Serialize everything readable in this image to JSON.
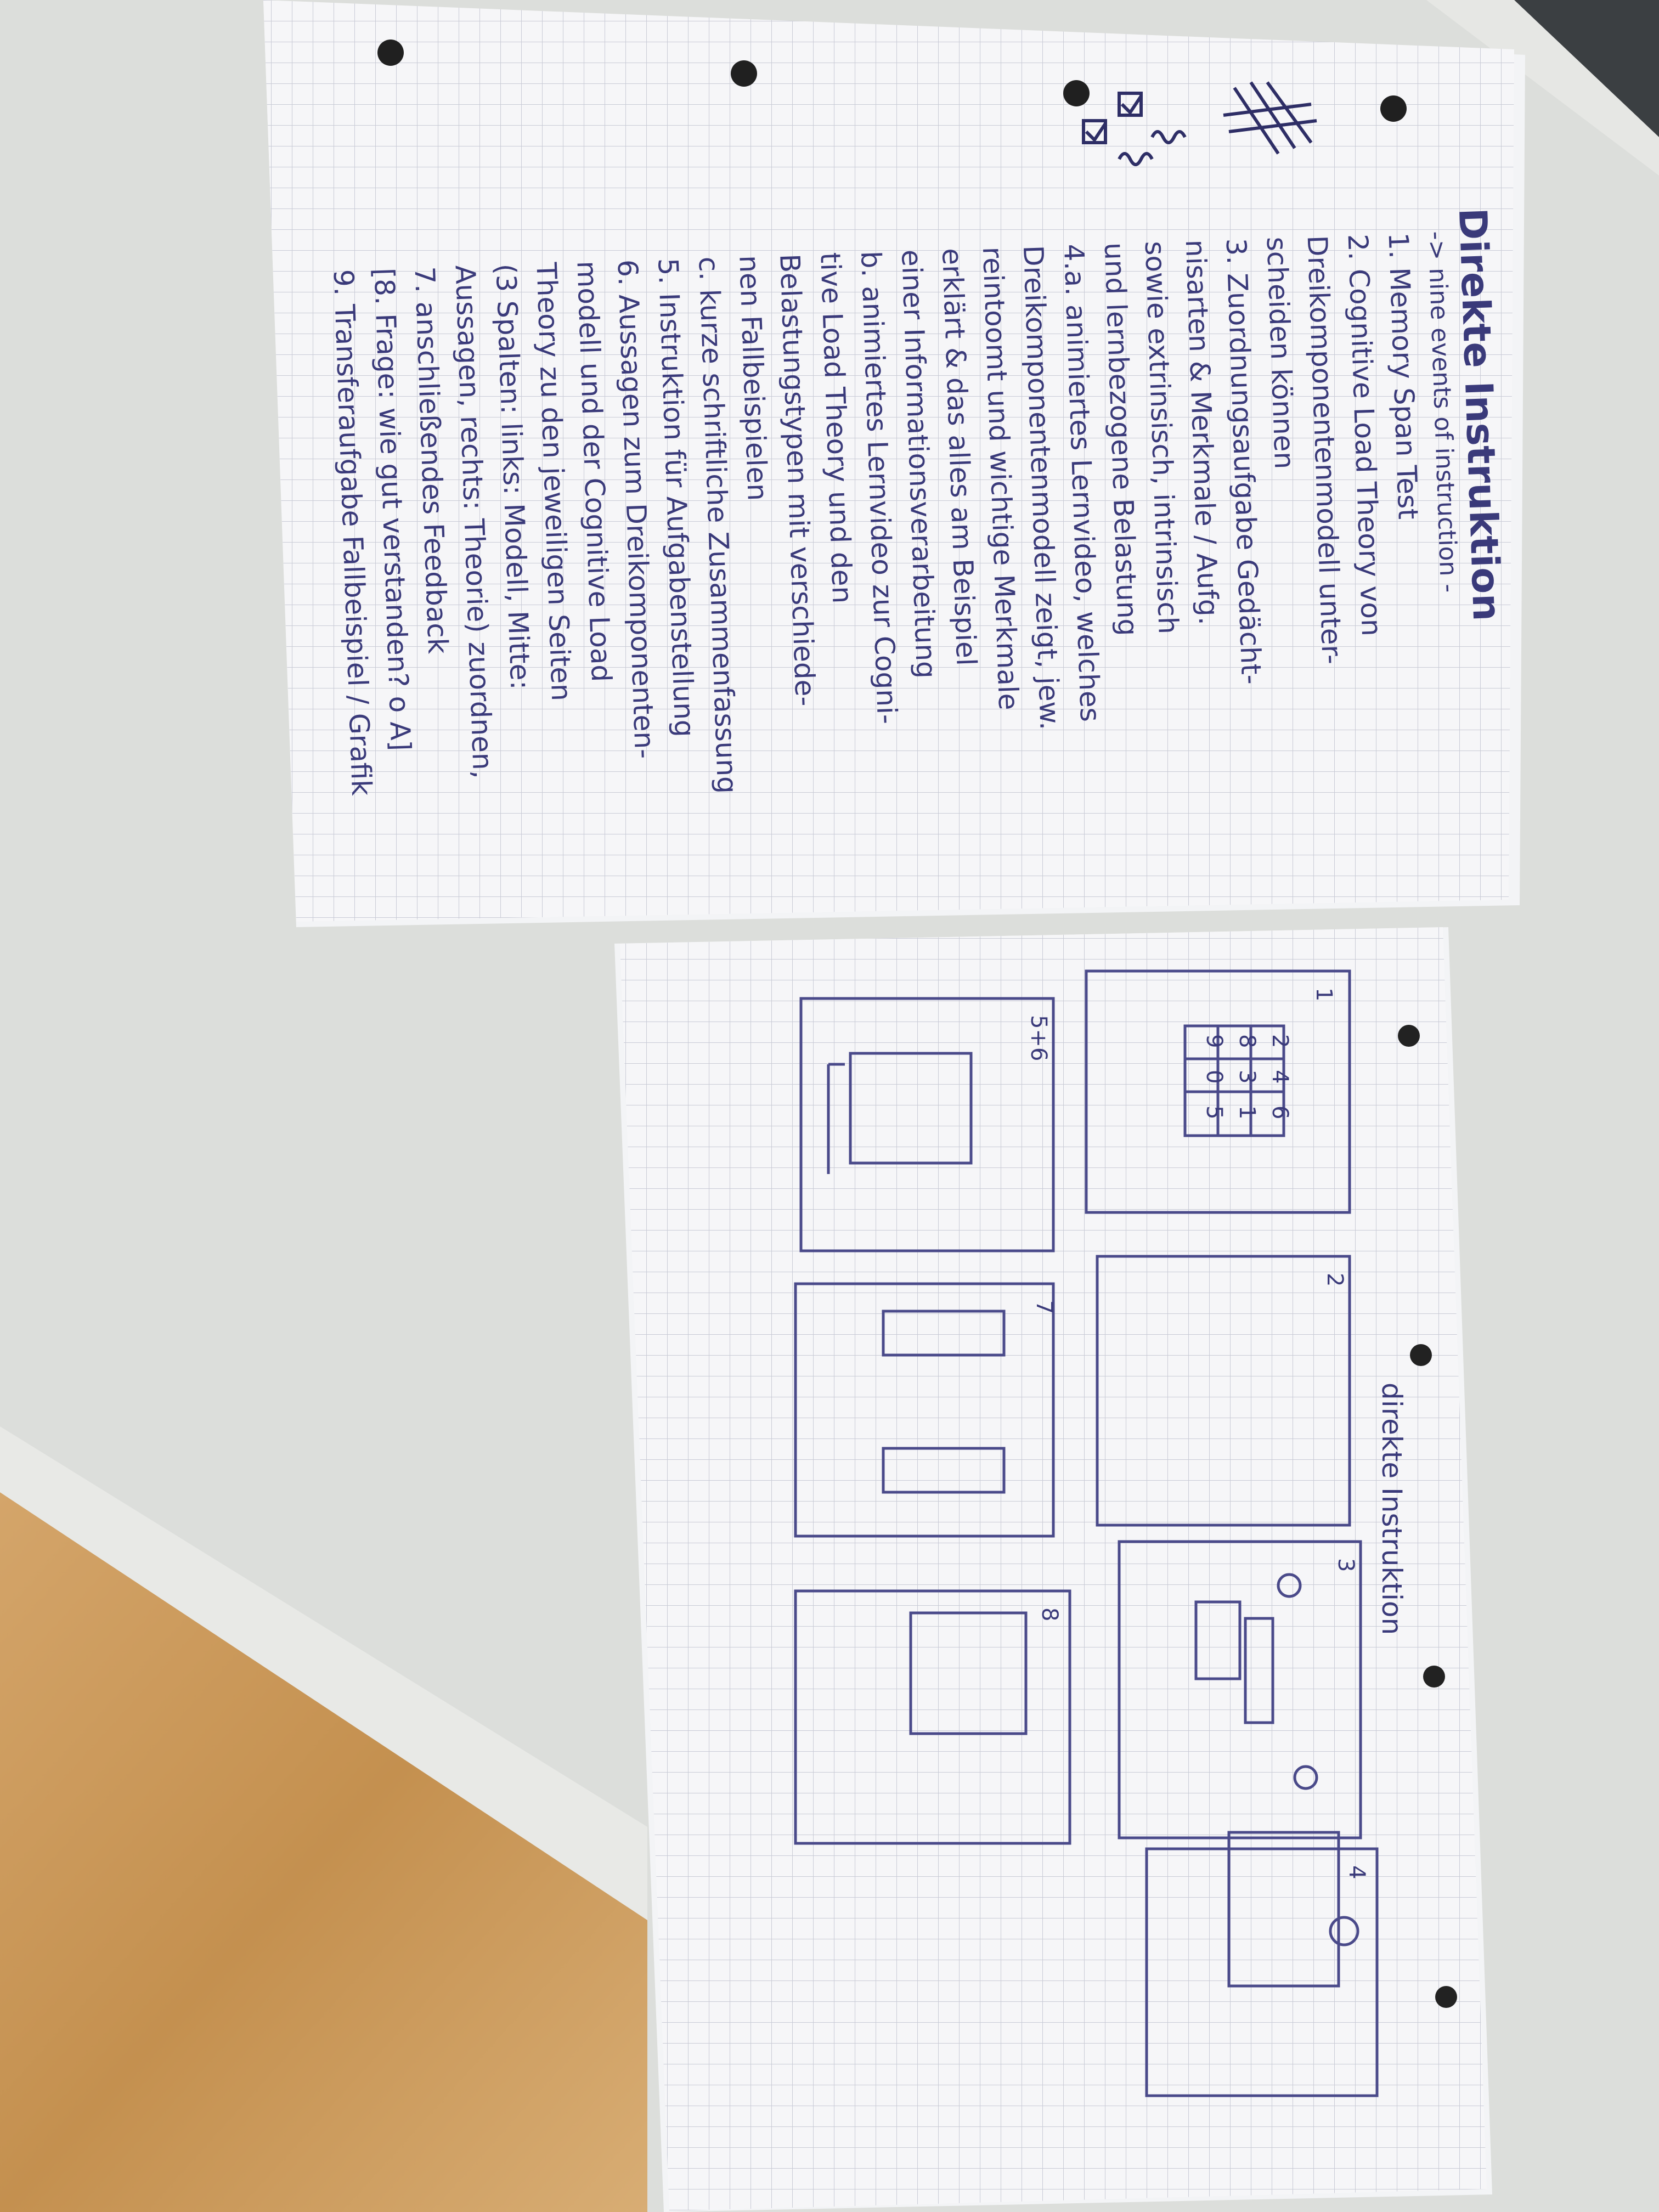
{
  "colors": {
    "desk": "#dcdedb",
    "wood": "#c99a5e",
    "paper": "#f6f6f8",
    "grid": "#c9cbd6",
    "ink": "#3a3a7a"
  },
  "note1": {
    "title": "Direkte Instruktion",
    "subtitle": "-> nine events of instruction -",
    "lines": [
      "1. Memory Span Test",
      "2. Cognitive Load Theory von",
      "   Dreikomponentenmodell unter-",
      "   scheiden können",
      "3. Zuordnungsaufgabe Gedächt-",
      "   nisarten & Merkmale / Aufg.",
      "   sowie extrinsisch, intrinsisch",
      "   und lernbezogene Belastung",
      "4.a. animiertes Lernvideo, welches",
      "   Dreikomponentenmodell zeigt, jew.",
      "   reintoomt und wichtige Merkmale",
      "   erklärt & das alles am Beispiel",
      "   einer Informationsverarbeitung",
      "b. animiertes Lernvideo zur Cogni-",
      "   tive Load Theory und den",
      "   Belastungstypen mit verschiede-",
      "   nen Fallbeispielen",
      "c. kurze schriftliche Zusammenfassung",
      "5. Instruktion für Aufgabenstellung",
      "6. Aussagen zum Dreikomponenten-",
      "   modell und der Cognitive Load",
      "   Theory zu den jeweiligen Seiten",
      "   (3 Spalten: links: Modell, Mitte:",
      "   Aussagen, rechts: Theorie) zuordnen,",
      "7. anschließendes Feedback",
      "[8. Frage: wie gut verstanden? o A]",
      "9. Transferaufgabe Fallbeispiel / Grafik"
    ]
  },
  "note2": {
    "title": "direkte Instruktion",
    "frame_labels": [
      "1",
      "2",
      "3",
      "4",
      "5+6",
      "7",
      "8"
    ],
    "grid_numbers": [
      "2",
      "4",
      "6",
      "8",
      "3",
      "1",
      "9",
      "0",
      "5"
    ]
  }
}
